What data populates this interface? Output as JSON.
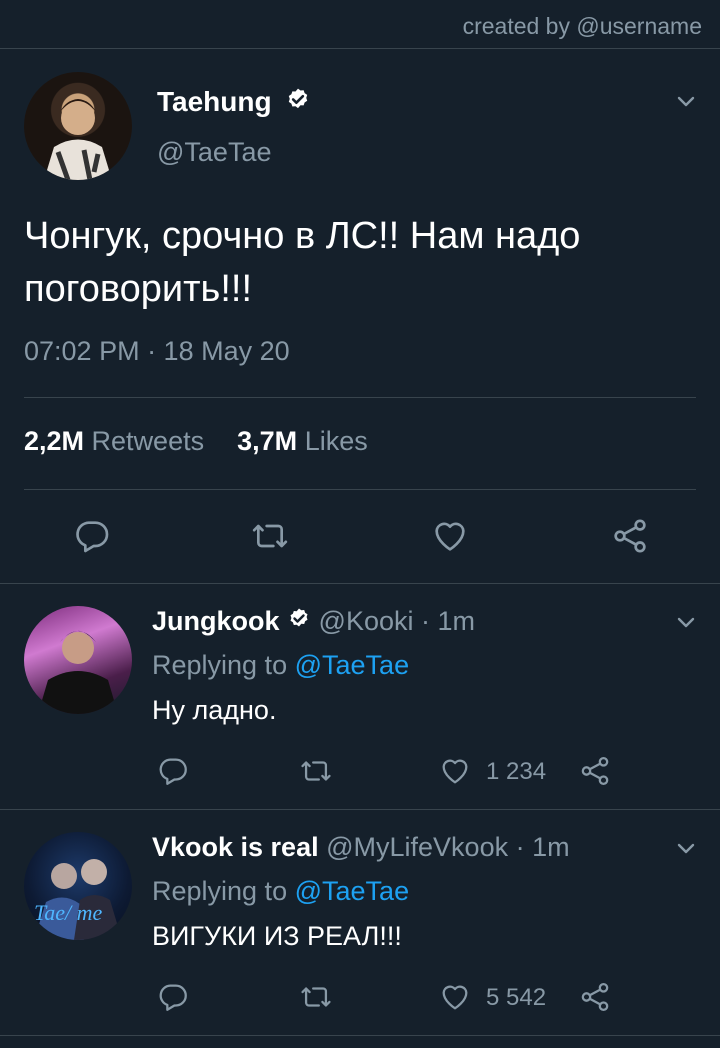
{
  "watermark": "created by @username",
  "main_tweet": {
    "name": "Taehung",
    "handle": "@TaeTae",
    "text": "Чонгук, срочно в ЛС!! Нам надо поговорить!!!",
    "timestamp": "07:02 PM · 18 May 20",
    "retweets_count": "2,2M",
    "retweets_label": "Retweets",
    "likes_count": "3,7M",
    "likes_label": "Likes"
  },
  "replies": [
    {
      "name": "Jungkook",
      "handle": "@Kooki",
      "time": "· 1m",
      "replying_prefix": "Replying to",
      "replying_to": "@TaeTae",
      "text": "Ну ладно.",
      "likes": "1 234"
    },
    {
      "name": "Vkook is real",
      "handle": "@MyLifeVkook",
      "time": "· 1m",
      "replying_prefix": "Replying to",
      "replying_to": "@TaeTae",
      "text": "ВИГУКИ ИЗ РЕАЛ!!!",
      "likes": "5 542"
    }
  ],
  "icons": [
    "verified-icon",
    "chevron-down-icon",
    "reply-icon",
    "retweet-icon",
    "like-icon",
    "share-icon"
  ],
  "colors": {
    "background": "#15202b",
    "muted": "#8899a6",
    "accent": "#1da1f2",
    "divider": "#38444d"
  }
}
